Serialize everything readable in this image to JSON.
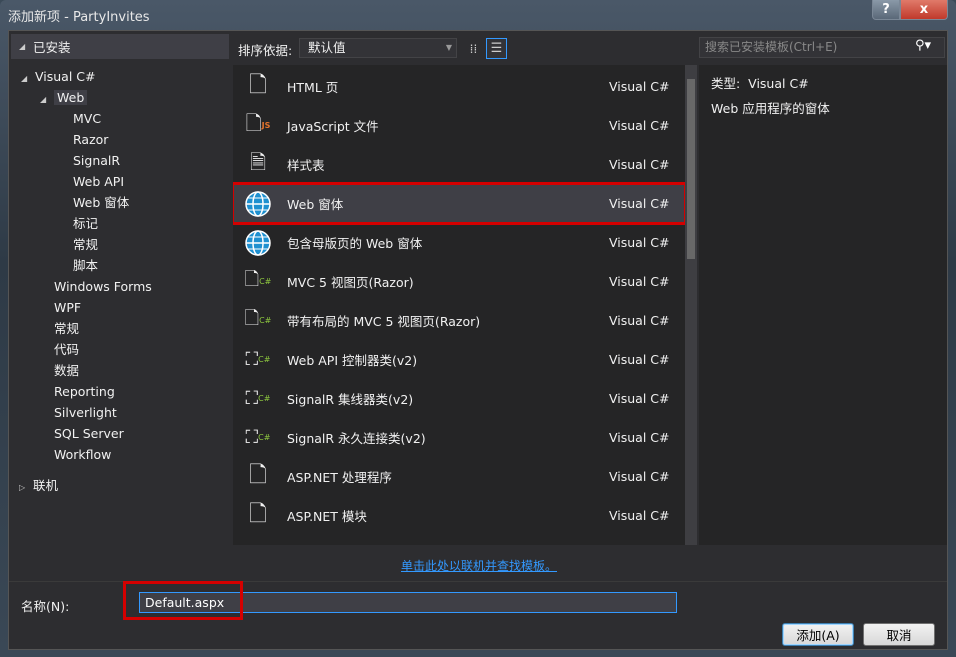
{
  "window": {
    "title": "添加新项 - PartyInvites",
    "help": "?",
    "close": "x"
  },
  "left": {
    "header": "已安装",
    "tree": [
      {
        "label": "Visual C#",
        "level": 0,
        "expanded": true
      },
      {
        "label": "Web",
        "level": 1,
        "expanded": true,
        "selected": true
      },
      {
        "label": "MVC",
        "level": 2
      },
      {
        "label": "Razor",
        "level": 2
      },
      {
        "label": "SignalR",
        "level": 2
      },
      {
        "label": "Web API",
        "level": 2
      },
      {
        "label": "Web 窗体",
        "level": 2
      },
      {
        "label": "标记",
        "level": 2
      },
      {
        "label": "常规",
        "level": 2
      },
      {
        "label": "脚本",
        "level": 2
      },
      {
        "label": "Windows Forms",
        "level": 1
      },
      {
        "label": "WPF",
        "level": 1
      },
      {
        "label": "常规",
        "level": 1
      },
      {
        "label": "代码",
        "level": 1
      },
      {
        "label": "数据",
        "level": 1
      },
      {
        "label": "Reporting",
        "level": 1
      },
      {
        "label": "Silverlight",
        "level": 1
      },
      {
        "label": "SQL Server",
        "level": 1
      },
      {
        "label": "Workflow",
        "level": 1
      }
    ],
    "online": "联机"
  },
  "toolbar": {
    "sort_label": "排序依据:",
    "sort_value": "默认值",
    "search_placeholder": "搜索已安装模板(Ctrl+E)"
  },
  "templates": [
    {
      "name": "HTML 页",
      "lang": "Visual C#",
      "icon": "html-page-icon"
    },
    {
      "name": "JavaScript 文件",
      "lang": "Visual C#",
      "icon": "javascript-file-icon"
    },
    {
      "name": "样式表",
      "lang": "Visual C#",
      "icon": "stylesheet-icon"
    },
    {
      "name": "Web 窗体",
      "lang": "Visual C#",
      "icon": "globe-icon",
      "selected": true
    },
    {
      "name": "包含母版页的 Web 窗体",
      "lang": "Visual C#",
      "icon": "globe-icon"
    },
    {
      "name": "MVC 5 视图页(Razor)",
      "lang": "Visual C#",
      "icon": "razor-view-icon"
    },
    {
      "name": "带有布局的 MVC 5 视图页(Razor)",
      "lang": "Visual C#",
      "icon": "razor-view-icon"
    },
    {
      "name": "Web API 控制器类(v2)",
      "lang": "Visual C#",
      "icon": "class-icon"
    },
    {
      "name": "SignalR 集线器类(v2)",
      "lang": "Visual C#",
      "icon": "class-icon"
    },
    {
      "name": "SignalR 永久连接类(v2)",
      "lang": "Visual C#",
      "icon": "class-icon"
    },
    {
      "name": "ASP.NET 处理程序",
      "lang": "Visual C#",
      "icon": "handler-icon"
    },
    {
      "name": "ASP.NET 模块",
      "lang": "Visual C#",
      "icon": "handler-icon"
    }
  ],
  "details": {
    "type_label": "类型:",
    "type_value": "Visual C#",
    "description": "Web 应用程序的窗体"
  },
  "online_link": "单击此处以联机并查找模板。",
  "name_field": {
    "label": "名称(N):",
    "value": "Default.aspx"
  },
  "buttons": {
    "add": "添加(A)",
    "cancel": "取消"
  },
  "colors": {
    "accent": "#3399ff",
    "highlight": "#d40000",
    "background": "#2d2d30"
  }
}
